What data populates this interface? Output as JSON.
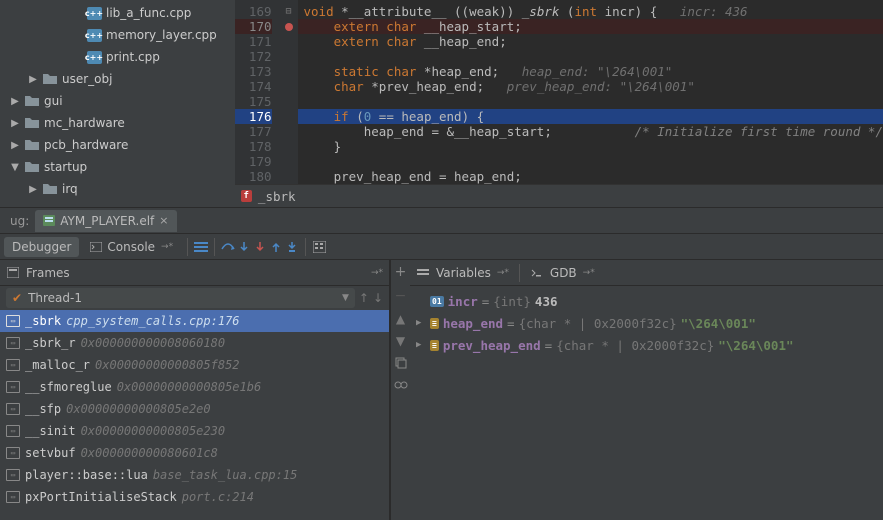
{
  "tree": {
    "files": [
      {
        "indent": 82,
        "icon": "cpp",
        "name": "lib_a_func.cpp"
      },
      {
        "indent": 82,
        "icon": "cpp",
        "name": "memory_layer.cpp"
      },
      {
        "indent": 82,
        "icon": "cpp",
        "name": "print.cpp"
      }
    ],
    "folders": [
      {
        "indent": 28,
        "expand": "▶",
        "name": "user_obj"
      },
      {
        "indent": 10,
        "expand": "▶",
        "name": "gui"
      },
      {
        "indent": 10,
        "expand": "▶",
        "name": "mc_hardware"
      },
      {
        "indent": 10,
        "expand": "▶",
        "name": "pcb_hardware"
      },
      {
        "indent": 10,
        "expand": "▼",
        "name": "startup"
      },
      {
        "indent": 28,
        "expand": "▶",
        "name": "irq"
      }
    ]
  },
  "editor": {
    "lines": [
      169,
      170,
      171,
      172,
      173,
      174,
      175,
      176,
      177,
      178,
      179,
      180
    ],
    "breakpoint_line": 170,
    "current_line": 176,
    "crumb_badge": "f",
    "crumb_fn": "_sbrk",
    "hints": {
      "l169": "incr: 436",
      "l173": "heap_end: \"\\264\\001\"",
      "l174": "prev_heap_end: \"\\264\\001\""
    },
    "code": {
      "l169_a": "void",
      "l169_b": " *__attribute__ ((weak)) ",
      "l169_c": "_sbrk",
      "l169_d": " (",
      "l169_e": "int",
      "l169_f": " incr) {   ",
      "l170_a": "extern char",
      "l170_b": " __heap_start;",
      "l171_a": "extern char",
      "l171_b": " __heap_end;",
      "l173_a": "static char",
      "l173_b": " *heap_end;   ",
      "l174_a": "char",
      "l174_b": " *prev_heap_end;   ",
      "l176_a": "if",
      "l176_b": " (",
      "l176_c": "0",
      "l176_d": " == heap_end) {",
      "l177_a": "    heap_end = &__heap_start;           ",
      "l177_b": "/* Initialize first time round */",
      "l178": "}",
      "l180": "prev_heap_end = heap_end;"
    }
  },
  "debug_tab": {
    "prefix": "ug:",
    "elf_name": "AYM_PLAYER.elf"
  },
  "toolbar": {
    "debugger": "Debugger",
    "console": "Console"
  },
  "frames": {
    "title": "Frames",
    "thread": "Thread-1",
    "items": [
      {
        "fn": "_sbrk",
        "loc": "cpp_system_calls.cpp:176",
        "sel": true
      },
      {
        "fn": "_sbrk_r",
        "loc": "0x000000000008060180"
      },
      {
        "fn": "_malloc_r",
        "loc": "0x00000000000805f852"
      },
      {
        "fn": "__sfmoreglue",
        "loc": "0x00000000000805e1b6"
      },
      {
        "fn": "__sfp",
        "loc": "0x00000000000805e2e0"
      },
      {
        "fn": "__sinit",
        "loc": "0x00000000000805e230"
      },
      {
        "fn": "setvbuf",
        "loc": "0x000000000080601c8"
      },
      {
        "fn": "player::base::lua",
        "loc": "base_task_lua.cpp:15"
      },
      {
        "fn": "pxPortInitialiseStack",
        "loc": "port.c:214"
      }
    ]
  },
  "vars": {
    "tab1": "Variables",
    "tab2": "GDB",
    "items": [
      {
        "badge": "oi",
        "badge_txt": "01",
        "arrow": "",
        "name": "incr",
        "type": "{int}",
        "val": "436",
        "val_color": "#bbb"
      },
      {
        "badge": "f",
        "badge_txt": "≡",
        "arrow": "▶",
        "name": "heap_end",
        "type": "{char * | 0x2000f32c}",
        "val": "\"\\264\\001\""
      },
      {
        "badge": "f",
        "badge_txt": "≡",
        "arrow": "▶",
        "name": "prev_heap_end",
        "type": "{char * | 0x2000f32c}",
        "val": "\"\\264\\001\""
      }
    ]
  }
}
